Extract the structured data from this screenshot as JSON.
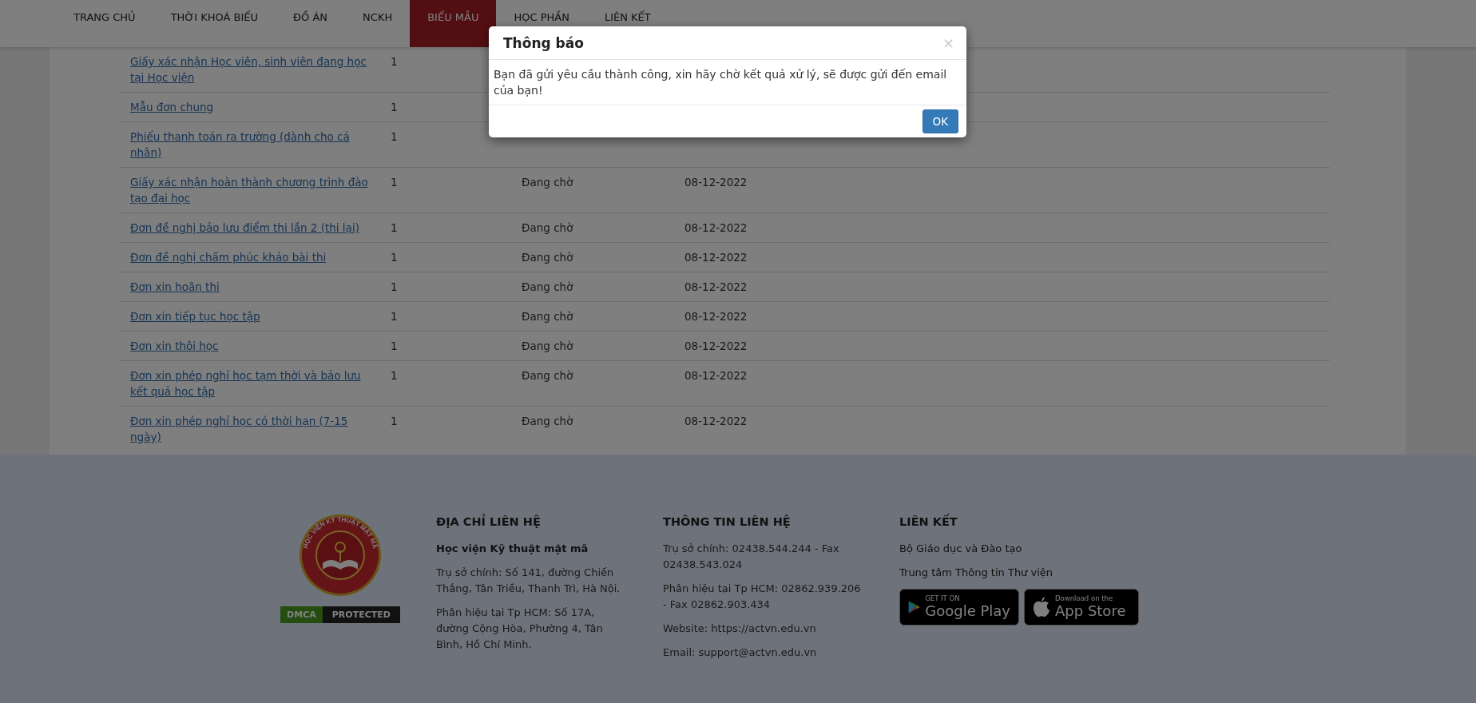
{
  "nav": {
    "items": [
      {
        "label": "TRANG CHỦ",
        "selected": false
      },
      {
        "label": "THỜI KHOÁ BIỂU",
        "selected": false
      },
      {
        "label": "ĐỒ ÁN",
        "selected": false
      },
      {
        "label": "NCKH",
        "selected": false
      },
      {
        "label": "BIỂU MẪU",
        "selected": true
      },
      {
        "label": "HỌC PHẦN",
        "selected": false
      },
      {
        "label": "LIÊN KẾT",
        "selected": false
      }
    ]
  },
  "table": {
    "rows": [
      {
        "name": "Giấy xác nhận Học viên, sinh viên đang học tại Học viện",
        "quantity": "1"
      },
      {
        "name": "Mẫu đơn chung",
        "quantity": "1"
      },
      {
        "name": "Phiếu thanh toán ra trường (dành cho cá nhân)",
        "quantity": "1"
      },
      {
        "name": "Giấy xác nhận hoàn thành chương trình đào tạo đại học",
        "quantity": "1",
        "status": "Đang chờ",
        "date": "08-12-2022"
      },
      {
        "name": "Đơn đề nghị bảo lưu điểm thi lần 2 (thi lại)",
        "quantity": "1",
        "status": "Đang chờ",
        "date": "08-12-2022"
      },
      {
        "name": "Đơn đề nghị chấm phúc khảo bài thi",
        "quantity": "1",
        "status": "Đang chờ",
        "date": "08-12-2022"
      },
      {
        "name": "Đơn xin hoãn thi",
        "quantity": "1",
        "status": "Đang chờ",
        "date": "08-12-2022"
      },
      {
        "name": "Đơn xin tiếp tục học tập",
        "quantity": "1",
        "status": "Đang chờ",
        "date": "08-12-2022"
      },
      {
        "name": "Đơn xin thôi học",
        "quantity": "1",
        "status": "Đang chờ",
        "date": "08-12-2022"
      },
      {
        "name": "Đơn xin phép nghỉ học tạm thời và bảo lưu kết quả học tập",
        "quantity": "1",
        "status": "Đang chờ",
        "date": "08-12-2022"
      },
      {
        "name": "Đơn xin phép nghỉ học có thời hạn (7-15 ngày)",
        "quantity": "1",
        "status": "Đang chờ",
        "date": "08-12-2022"
      }
    ]
  },
  "modal": {
    "title": "Thông báo",
    "close": "×",
    "message": "Bạn đã gửi yêu cầu thành công, xin hãy chờ kết quả xử lý, sẽ được gửi đến email của bạn!",
    "button": "OK"
  },
  "footer": {
    "logo": {
      "top_text": "HỌC VIỆN KỸ THUẬT MẬT MÃ"
    },
    "dmca": {
      "left": "DMCA",
      "right": "PROTECTED"
    },
    "address": {
      "heading": "ĐỊA CHỈ LIÊN HỆ",
      "org": "Học viện Kỹ thuật mật mã",
      "lines": [
        "Trụ sở chính: Số 141, đường Chiến Thắng, Tân Triều, Thanh Trì, Hà Nội.",
        "Phân hiệu tại Tp HCM: Số 17A, đường Cộng Hòa, Phường 4, Tân Bình, Hồ Chí Minh."
      ]
    },
    "contact": {
      "heading": "THÔNG TIN LIÊN HỆ",
      "lines": [
        "Trụ sở chính: 02438.544.244 - Fax 02438.543.024",
        "Phân hiệu tại Tp HCM: 02862.939.206 - Fax 02862.903.434",
        "Website: https://actvn.edu.vn",
        "Email: support@actvn.edu.vn"
      ]
    },
    "links": {
      "heading": "LIÊN KẾT",
      "items": [
        "Bộ Giáo dục và Đào tạo",
        "Trung tâm Thông tin Thư viện"
      ],
      "stores": [
        {
          "kind": "google",
          "small": "GET IT ON",
          "big": "Google Play"
        },
        {
          "kind": "apple",
          "small": "Download on the",
          "big": "App Store"
        }
      ]
    }
  }
}
